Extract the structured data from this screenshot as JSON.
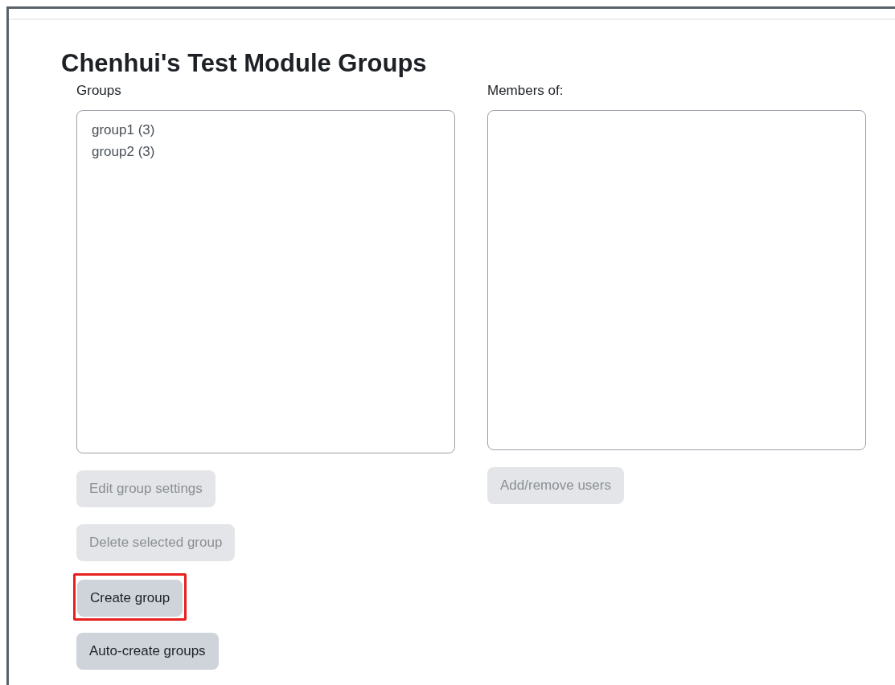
{
  "title": "Chenhui's Test Module Groups",
  "groups_panel": {
    "label": "Groups",
    "items": [
      "group1 (3)",
      "group2 (3)"
    ],
    "buttons": [
      {
        "label": "Edit group settings",
        "disabled": true,
        "highlighted": false
      },
      {
        "label": "Delete selected group",
        "disabled": true,
        "highlighted": false
      },
      {
        "label": "Create group",
        "disabled": false,
        "highlighted": true
      },
      {
        "label": "Auto-create groups",
        "disabled": false,
        "highlighted": false
      }
    ]
  },
  "members_panel": {
    "label": "Members of:",
    "buttons": [
      {
        "label": "Add/remove users",
        "disabled": true,
        "highlighted": false
      }
    ]
  }
}
